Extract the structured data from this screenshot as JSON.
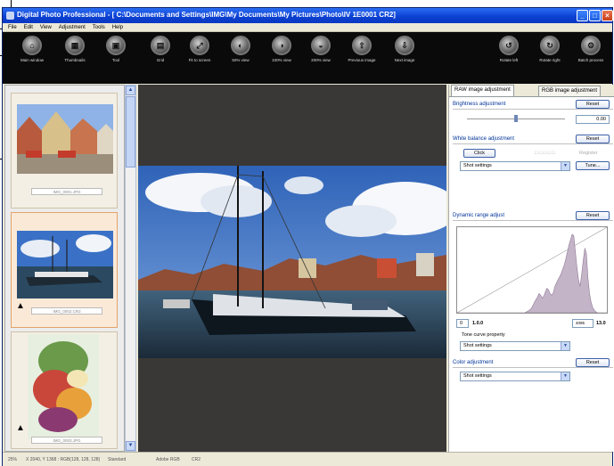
{
  "window": {
    "title": "Digital Photo Professional - [ C:\\Documents and Settings\\IMG\\My Documents\\My Pictures\\Photo\\IV 1E0001 CR2]",
    "controls": [
      "_",
      "□",
      "×"
    ]
  },
  "menu": [
    "File",
    "Edit",
    "View",
    "Adjustment",
    "Tools",
    "Help"
  ],
  "toolbar": {
    "items": [
      {
        "label": "Main window",
        "icon": "home-icon"
      },
      {
        "label": "Thumbnails",
        "icon": "thumbnails-icon"
      },
      {
        "label": "Tool",
        "icon": "tool-icon"
      },
      {
        "label": "Grid",
        "icon": "grid-icon"
      },
      {
        "label": "Fit to screen",
        "icon": "fit-screen-icon"
      },
      {
        "label": "50% view",
        "icon": "zoom-50-icon"
      },
      {
        "label": "100% view",
        "icon": "zoom-100-icon"
      },
      {
        "label": "200% view",
        "icon": "zoom-200-icon"
      },
      {
        "label": "Previous image",
        "icon": "previous-icon"
      },
      {
        "label": "Next image",
        "icon": "next-icon"
      },
      {
        "label": "Rotate left",
        "icon": "rotate-left-icon"
      },
      {
        "label": "Rotate right",
        "icon": "rotate-right-icon"
      },
      {
        "label": "Batch process",
        "icon": "batch-icon"
      }
    ]
  },
  "thumbnails": [
    {
      "caption": "IMG_0001.JPG",
      "selected": false
    },
    {
      "caption": "IMG_0002.CR2",
      "selected": true
    },
    {
      "caption": "IMG_0003.JPG",
      "selected": false
    }
  ],
  "panel": {
    "tabs": [
      "RAW image adjustment",
      "RGB image adjustment"
    ],
    "brightness": {
      "heading": "Brightness adjustment",
      "reset": "Reset",
      "value": "0.00",
      "level": 0.5
    },
    "white_balance": {
      "heading": "White balance adjustment",
      "reset": "Reset",
      "click": "Click",
      "register": "Register",
      "preset": "Shot settings",
      "tune": "Tune..."
    },
    "dynamic_range": {
      "heading": "Dynamic range adjust",
      "reset": "Reset",
      "low": "0",
      "low_value": "1.0.0",
      "high": "4095",
      "high_value": "13.0"
    },
    "tone_curve": {
      "label": "Tone curve property",
      "value": "Shot settings"
    },
    "color": {
      "heading": "Color adjustment",
      "reset": "Reset",
      "value": "Shot settings"
    }
  },
  "status": {
    "zoom": "25%",
    "pixel": "X 2040, Y 1368 : RGB(128, 128, 128)",
    "quality": "Standard",
    "color_space": "Adobe RGB",
    "format": "CR2"
  },
  "histogram_bins": [
    0,
    0,
    0,
    0,
    0,
    0,
    0,
    0,
    0,
    0,
    0,
    0,
    0,
    0,
    0,
    0,
    0,
    0,
    0,
    0,
    0,
    0,
    0,
    0,
    0,
    0,
    0,
    0,
    0,
    0,
    0,
    0,
    0,
    0,
    0,
    0,
    0,
    0,
    0,
    0,
    0,
    0,
    0,
    0,
    1,
    2,
    3,
    5,
    8,
    12,
    15,
    18,
    22,
    20,
    17,
    19,
    24,
    28,
    26,
    22,
    20,
    23,
    30,
    34,
    38,
    41,
    45,
    50,
    55,
    62,
    70,
    78,
    84,
    90,
    88,
    70,
    52,
    38,
    30,
    44,
    60,
    74,
    68,
    40,
    22,
    12,
    6,
    3,
    1,
    0,
    0,
    0,
    0,
    0,
    0,
    0
  ],
  "colors": {
    "titlebar": "#0b3fd0",
    "toolbar": "#0a0a0a",
    "preview_bg": "#3a3836",
    "histogram": "#c4b4c8",
    "accent": "#003399"
  }
}
